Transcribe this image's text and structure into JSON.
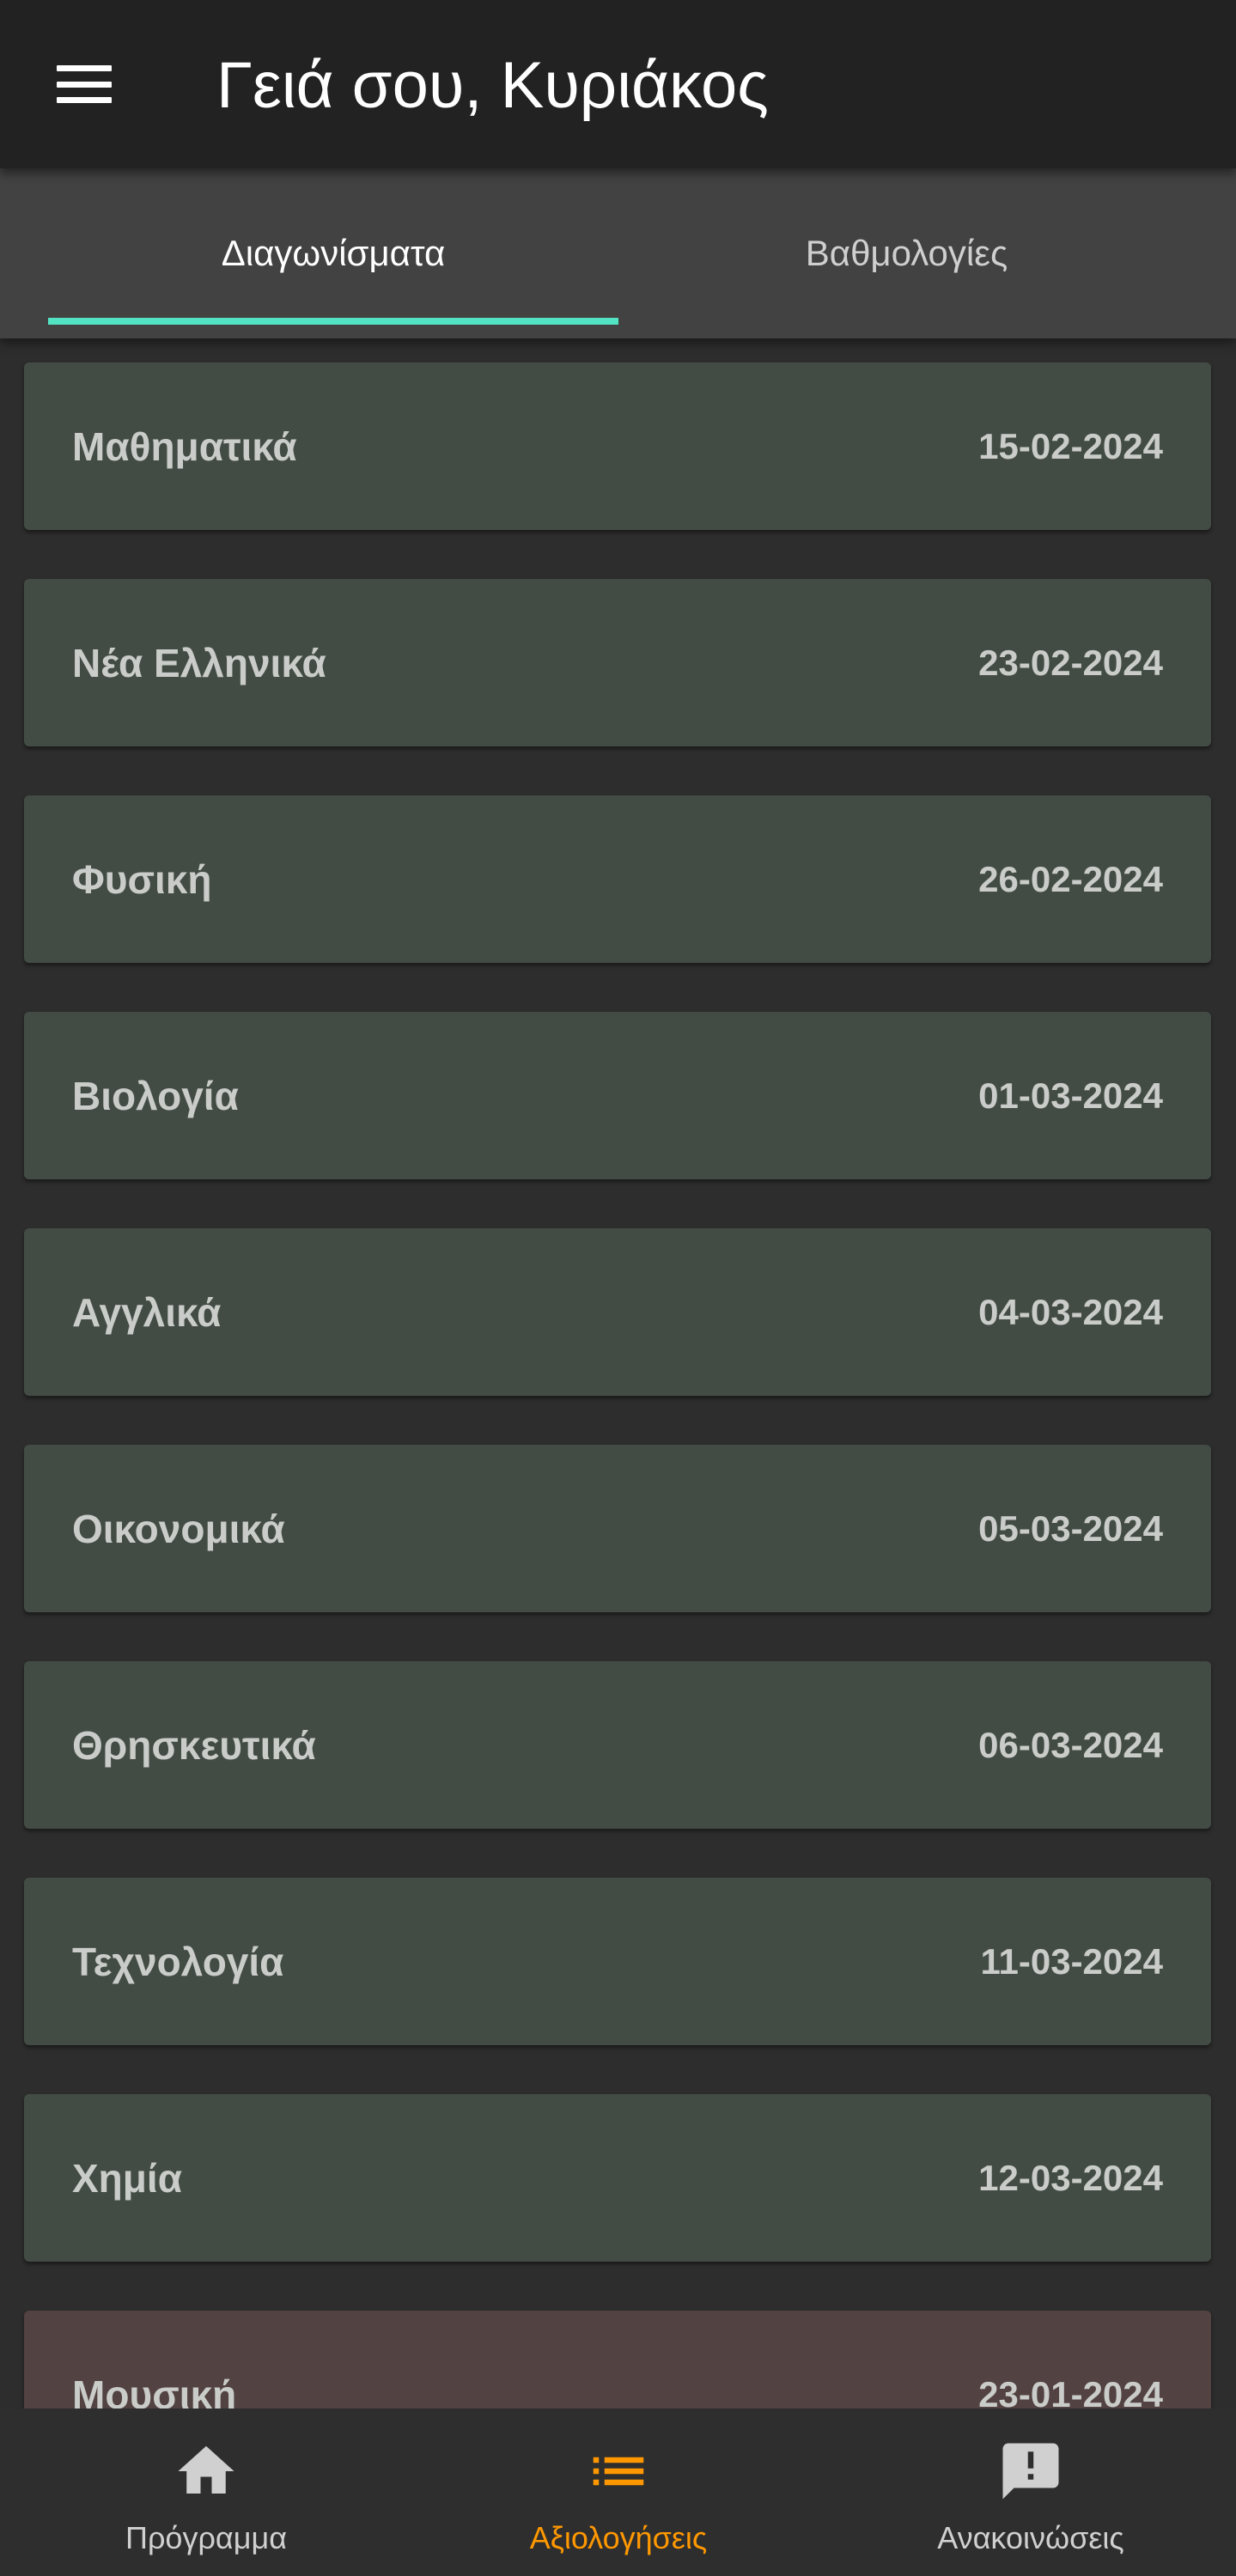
{
  "appbar": {
    "menu_icon": "menu-icon",
    "title": "Γειά σου, Κυριάκος"
  },
  "tabs": [
    {
      "label": "Διαγωνίσματα",
      "selected": true
    },
    {
      "label": "Βαθμολογίες",
      "selected": false
    }
  ],
  "colors": {
    "indicator": "#52e3c2",
    "upcoming_card": "#434c44",
    "past_card": "#524241",
    "card_text": "#c9ccc9",
    "nav_active": "#ff9800",
    "nav_inactive": "#d0d0d0"
  },
  "exams": [
    {
      "subject": "Μαθηματικά",
      "date": "15-02-2024",
      "status": "upcoming"
    },
    {
      "subject": "Νέα Ελληνικά",
      "date": "23-02-2024",
      "status": "upcoming"
    },
    {
      "subject": "Φυσική",
      "date": "26-02-2024",
      "status": "upcoming"
    },
    {
      "subject": "Βιολογία",
      "date": "01-03-2024",
      "status": "upcoming"
    },
    {
      "subject": "Αγγλικά",
      "date": "04-03-2024",
      "status": "upcoming"
    },
    {
      "subject": "Οικονομικά",
      "date": "05-03-2024",
      "status": "upcoming"
    },
    {
      "subject": "Θρησκευτικά",
      "date": "06-03-2024",
      "status": "upcoming"
    },
    {
      "subject": "Τεχνολογία",
      "date": "11-03-2024",
      "status": "upcoming"
    },
    {
      "subject": "Χημία",
      "date": "12-03-2024",
      "status": "upcoming"
    },
    {
      "subject": "Μουσική",
      "date": "23-01-2024",
      "status": "past"
    }
  ],
  "bottom_nav": [
    {
      "label": "Πρόγραμμα",
      "icon": "home-icon",
      "active": false
    },
    {
      "label": "Αξιολογήσεις",
      "icon": "list-icon",
      "active": true
    },
    {
      "label": "Ανακοινώσεις",
      "icon": "announcement-icon",
      "active": false
    }
  ]
}
